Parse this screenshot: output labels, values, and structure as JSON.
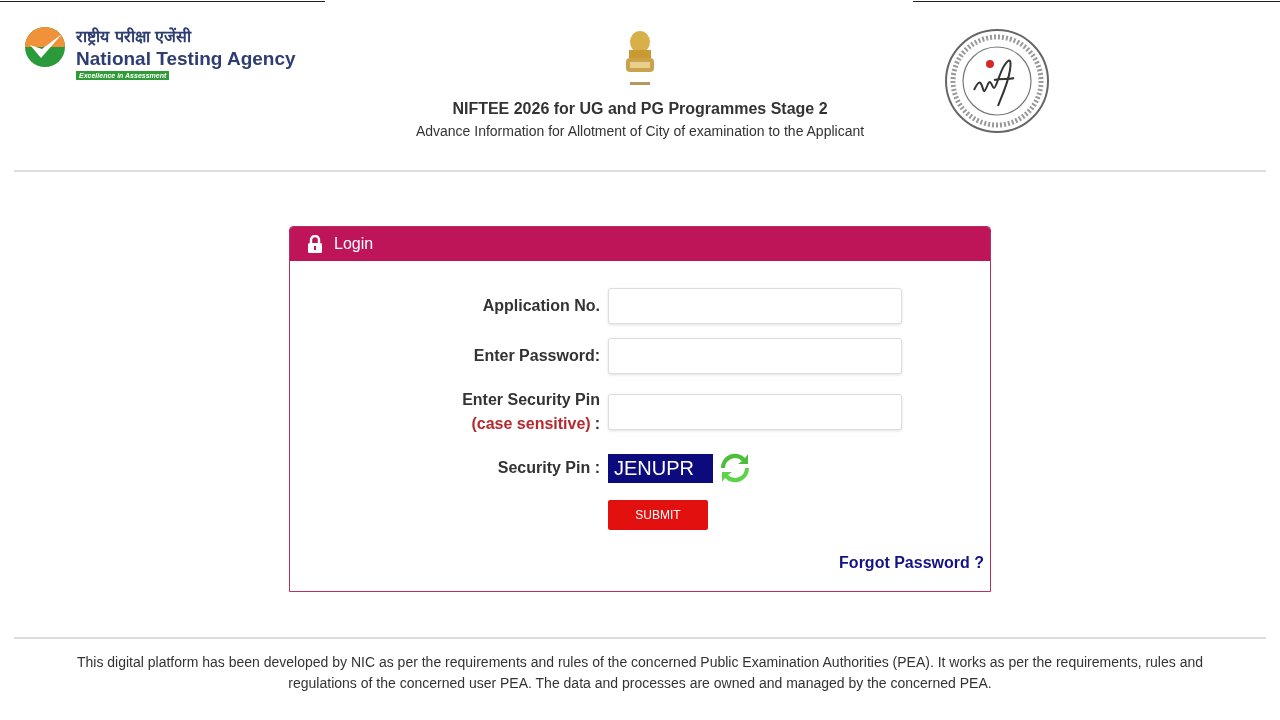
{
  "header": {
    "nta_logo": {
      "hindi": "राष्ट्रीय परीक्षा एजेंसी",
      "name": "National Testing Agency",
      "tagline": "Excellence in Assessment"
    },
    "title": "NIFTEE 2026 for UG and PG Programmes Stage 2",
    "subtitle": "Advance Information for Allotment of City of examination to the Applicant"
  },
  "login": {
    "title": "Login",
    "fields": [
      {
        "label": "Application No."
      },
      {
        "label": "Enter Password:"
      },
      {
        "label": "Enter Security Pin",
        "note": "(case sensitive)",
        "colon": ":"
      }
    ],
    "security_pin": {
      "label": "Security Pin :",
      "code": "JENUPR"
    },
    "submit": "SUBMIT",
    "forgot": "Forgot Password ?"
  },
  "footer": "This digital platform has been developed by NIC as per the requirements and rules of the concerned Public Examination Authorities (PEA). It works as per the requirements, rules and regulations of the concerned user PEA. The data and processes are owned and managed by the concerned PEA."
}
